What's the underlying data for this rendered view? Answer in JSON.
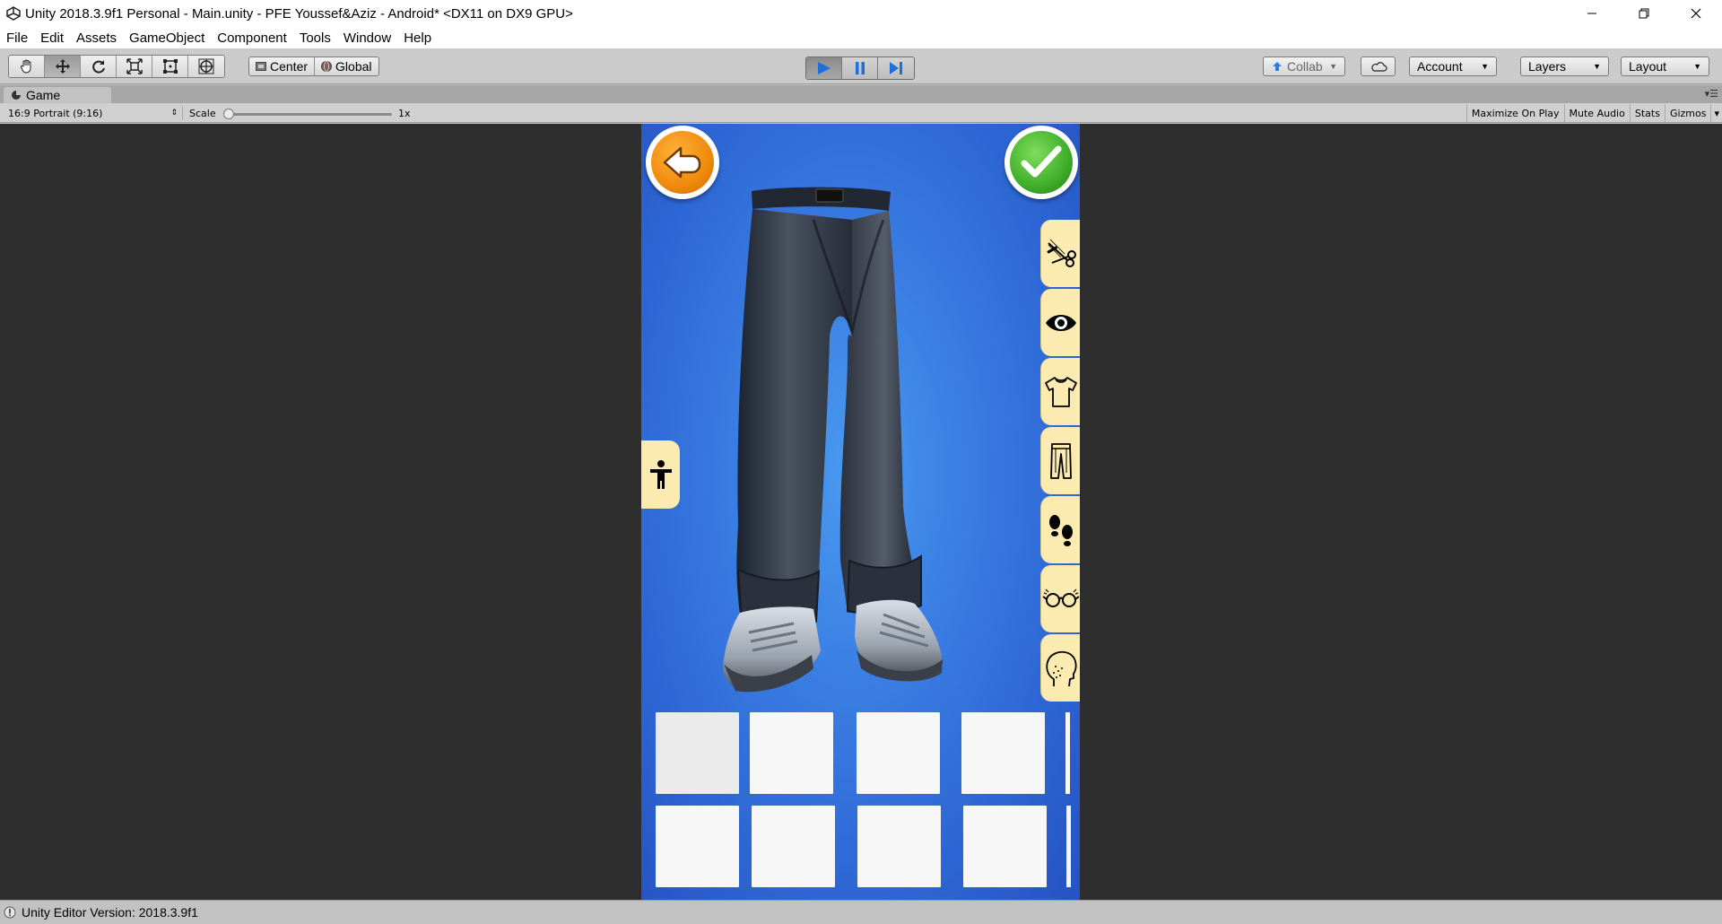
{
  "window": {
    "title": "Unity 2018.3.9f1 Personal - Main.unity - PFE Youssef&Aziz - Android* <DX11 on DX9 GPU>"
  },
  "menu": [
    "File",
    "Edit",
    "Assets",
    "GameObject",
    "Component",
    "Tools",
    "Window",
    "Help"
  ],
  "toolbar": {
    "tools": [
      "hand-tool-icon",
      "move-tool-icon",
      "rotate-tool-icon",
      "scale-tool-icon",
      "rect-tool-icon",
      "transform-tool-icon"
    ],
    "active_tool": "move-tool-icon",
    "pivot_center_label": "Center",
    "pivot_global_label": "Global",
    "play_state": "playing",
    "collab_label": "Collab",
    "account_label": "Account",
    "layers_label": "Layers",
    "layout_label": "Layout"
  },
  "game_view": {
    "tab_label": "Game",
    "aspect": "16:9 Portrait (9:16)",
    "scale_label": "Scale",
    "scale_value": "1x",
    "maximize_label": "Maximize On Play",
    "mute_label": "Mute Audio",
    "stats_label": "Stats",
    "gizmos_label": "Gizmos"
  },
  "game": {
    "back_button": "back-arrow-icon",
    "confirm_button": "checkmark-icon",
    "categories": [
      "hair-scissors-icon",
      "eye-icon",
      "tshirt-icon",
      "pants-icon",
      "footprints-icon",
      "glasses-icon",
      "face-icon"
    ],
    "left_button": "body-figure-icon",
    "slot_rows": 2,
    "slot_cols": 4,
    "colors": {
      "background": "#3a7ee3",
      "panel": "#fcebb1",
      "back_orange": "#f08a0c",
      "confirm_green": "#3fae2a"
    }
  },
  "status": {
    "text": "Unity Editor Version: 2018.3.9f1"
  }
}
